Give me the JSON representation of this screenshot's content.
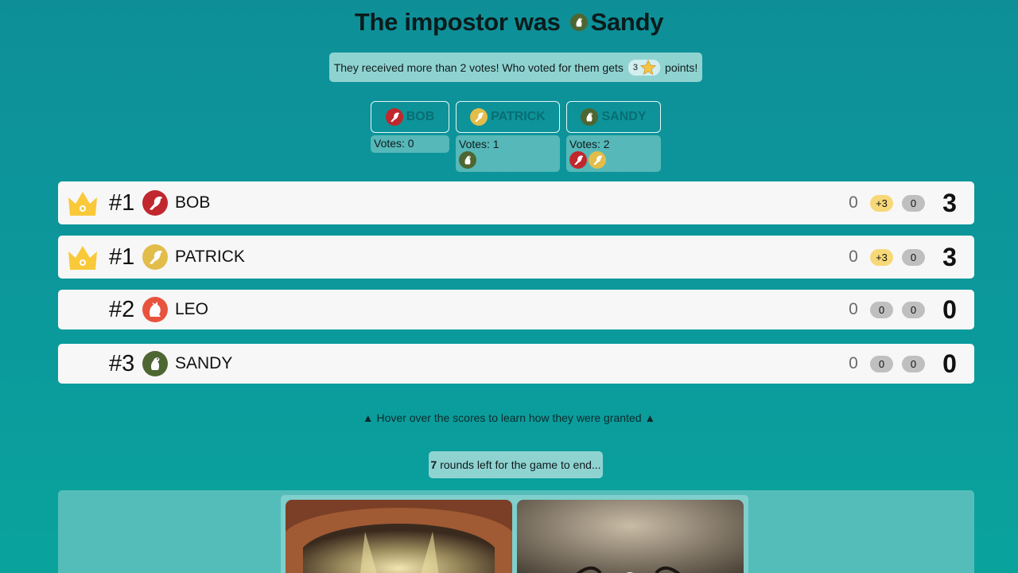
{
  "header": {
    "title_prefix": "The impostor was",
    "impostor": "Sandy",
    "impostor_icon": "sandy-avatar-icon"
  },
  "notice": {
    "text_before": "They received more than 2 votes! Who voted for them gets",
    "points_value": "3",
    "points_icon": "star-icon",
    "text_after": "points!"
  },
  "votes": [
    {
      "name": "BOB",
      "icon": "bob-avatar-icon",
      "votes_label": "Votes: 0",
      "voters": []
    },
    {
      "name": "PATRICK",
      "icon": "patrick-avatar-icon",
      "votes_label": "Votes: 1",
      "voters": [
        "sandy-avatar-icon"
      ]
    },
    {
      "name": "SANDY",
      "icon": "sandy-avatar-icon",
      "votes_label": "Votes: 2",
      "voters": [
        "bob-avatar-icon",
        "patrick-avatar-icon"
      ]
    }
  ],
  "scoreboard": [
    {
      "rank": "#1",
      "name": "BOB",
      "crown": true,
      "previous": "0",
      "bonus": "+3",
      "other": "0",
      "total": "3"
    },
    {
      "rank": "#1",
      "name": "PATRICK",
      "crown": true,
      "previous": "0",
      "bonus": "+3",
      "other": "0",
      "total": "3"
    },
    {
      "rank": "#2",
      "name": "LEO",
      "crown": false,
      "previous": "0",
      "bonus": "0",
      "other": "0",
      "total": "0"
    },
    {
      "rank": "#3",
      "name": "SANDY",
      "crown": false,
      "previous": "0",
      "bonus": "0",
      "other": "0",
      "total": "0"
    }
  ],
  "hint": "Hover over the scores to learn how they were granted",
  "rounds": {
    "count": "7",
    "text": "rounds left for the game to end..."
  },
  "colors": {
    "bob": "#c0282d",
    "patrick": "#e2bd4a",
    "leo": "#e8533d",
    "sandy": "#4e6631",
    "crown": "#f9c93a",
    "background": "#0b9a9c"
  }
}
